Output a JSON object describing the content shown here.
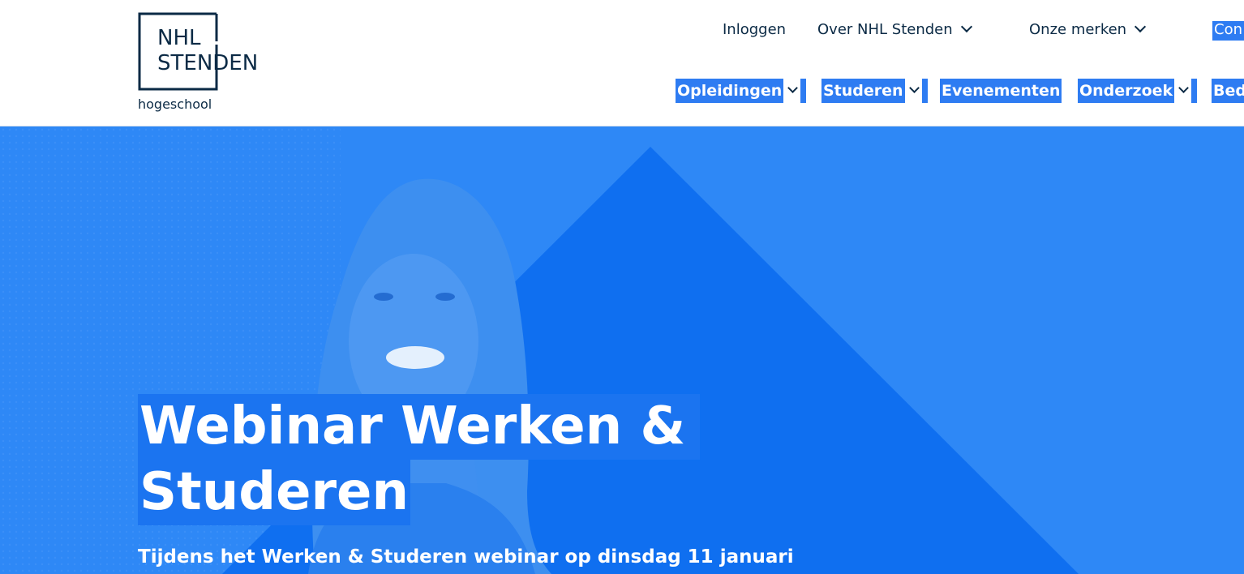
{
  "logo": {
    "line1": "NHL",
    "line2": "STENDEN",
    "subtitle": "hogeschool"
  },
  "top_nav": {
    "login": "Inloggen",
    "about": "Over NHL Stenden",
    "brands": "Onze merken",
    "contact": "Con"
  },
  "main_nav": [
    {
      "label": "Opleidingen",
      "has_dropdown": true
    },
    {
      "label": "Studeren",
      "has_dropdown": true
    },
    {
      "label": "Evenementen",
      "has_dropdown": false
    },
    {
      "label": "Onderzoek",
      "has_dropdown": true
    },
    {
      "label": "Bed",
      "has_dropdown": false
    }
  ],
  "hero": {
    "title_line1": "Webinar Werken &",
    "title_line2": "Studeren",
    "subtitle": "Tijdens het Werken & Studeren webinar op dinsdag 11 januari"
  },
  "colors": {
    "brand_dark": "#0b2a45",
    "accent_blue": "#2e7cf2",
    "hero_blue": "#2e88f6",
    "triangle_blue": "#0f6ff0"
  },
  "icons": [
    "chevron-down-icon",
    "logo-square-icon"
  ]
}
